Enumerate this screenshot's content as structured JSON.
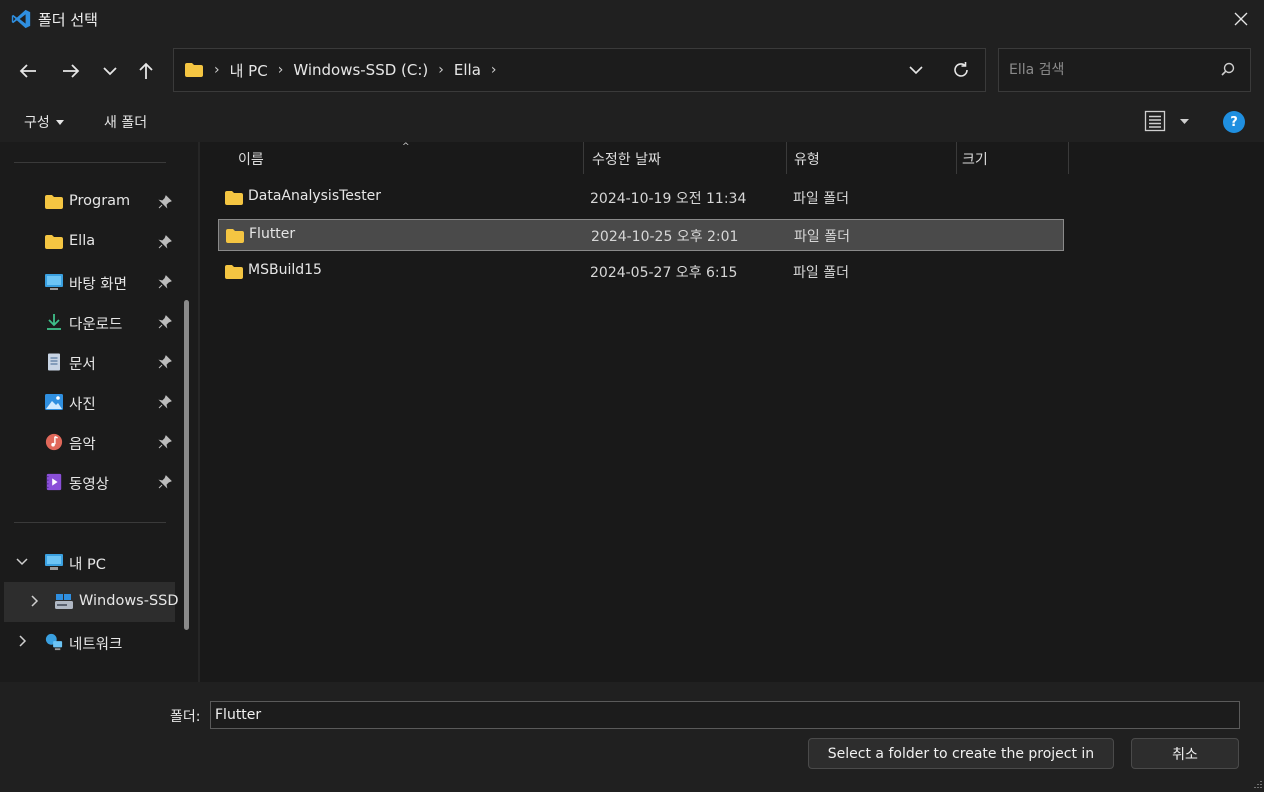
{
  "window": {
    "title": "폴더 선택"
  },
  "address": {
    "crumbs": [
      "내 PC",
      "Windows-SSD (C:)",
      "Ella"
    ]
  },
  "search": {
    "placeholder": "Ella 검색"
  },
  "toolbar": {
    "organize_label": "구성",
    "new_folder_label": "새 폴더"
  },
  "sidebar": {
    "quick": [
      {
        "label": "Program",
        "icon": "folder-icon"
      },
      {
        "label": "Ella",
        "icon": "folder-icon"
      },
      {
        "label": "바탕 화면",
        "icon": "desktop-icon"
      },
      {
        "label": "다운로드",
        "icon": "download-icon"
      },
      {
        "label": "문서",
        "icon": "document-icon"
      },
      {
        "label": "사진",
        "icon": "pictures-icon"
      },
      {
        "label": "음악",
        "icon": "music-icon"
      },
      {
        "label": "동영상",
        "icon": "video-icon"
      }
    ],
    "tree": [
      {
        "label": "내 PC",
        "icon": "pc-icon"
      },
      {
        "label": "Windows-SSD",
        "icon": "drive-icon"
      },
      {
        "label": "네트워크",
        "icon": "network-icon"
      }
    ]
  },
  "columns": {
    "name": "이름",
    "date": "수정한 날짜",
    "type": "유형",
    "size": "크기"
  },
  "files": [
    {
      "name": "DataAnalysisTester",
      "date": "2024-10-19 오전 11:34",
      "type": "파일 폴더",
      "selected": false
    },
    {
      "name": "Flutter",
      "date": "2024-10-25 오후 2:01",
      "type": "파일 폴더",
      "selected": true
    },
    {
      "name": "MSBuild15",
      "date": "2024-05-27 오후 6:15",
      "type": "파일 폴더",
      "selected": false
    }
  ],
  "footer": {
    "folder_label": "폴더:",
    "folder_value": "Flutter",
    "select_button": "Select a folder to create the project in",
    "cancel_button": "취소"
  },
  "colors": {
    "accent": "#1f8fe0",
    "folder": "#f4c542",
    "background": "#191919"
  }
}
